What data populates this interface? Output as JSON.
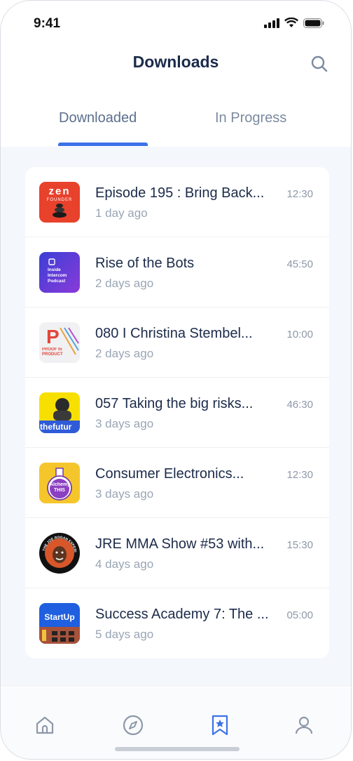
{
  "status": {
    "time": "9:41"
  },
  "header": {
    "title": "Downloads"
  },
  "tabs": [
    {
      "label": "Downloaded",
      "active": true
    },
    {
      "label": "In Progress",
      "active": false
    }
  ],
  "episodes": [
    {
      "title": "Episode 195 : Bring Back...",
      "date": "1 day ago",
      "duration": "12:30",
      "art": "zen-founder-art",
      "art_text": "zen",
      "art_subtext": "FOUNDER"
    },
    {
      "title": "Rise of the Bots",
      "date": "2 days ago",
      "duration": "45:50",
      "art": "inside-intercom-art",
      "art_text": "Inside Intercom Podcast"
    },
    {
      "title": "080 I Christina Stembel...",
      "date": "2 days ago",
      "duration": "10:00",
      "art": "proof-to-product-art",
      "art_text": "PROOF to PRODUCT"
    },
    {
      "title": "057 Taking the big risks...",
      "date": "3 days ago",
      "duration": "46:30",
      "art": "the-futur-art",
      "art_text": "thefutur"
    },
    {
      "title": "Consumer Electronics...",
      "date": "3 days ago",
      "duration": "12:30",
      "art": "alchemy-this-art",
      "art_text": "Alchemy THIS"
    },
    {
      "title": "JRE MMA Show #53 with...",
      "date": "4 days ago",
      "duration": "15:30",
      "art": "joe-rogan-art",
      "art_text": "THE JOE ROGAN EXPERIENCE"
    },
    {
      "title": "Success Academy 7: The ...",
      "date": "5 days ago",
      "duration": "05:00",
      "art": "startup-art",
      "art_text": "StartUp"
    }
  ],
  "nav": [
    {
      "icon": "home-icon",
      "active": false
    },
    {
      "icon": "compass-icon",
      "active": false
    },
    {
      "icon": "bookmark-star-icon",
      "active": true
    },
    {
      "icon": "profile-icon",
      "active": false
    }
  ],
  "colors": {
    "accent": "#3d72e8",
    "title": "#1c2b4a",
    "muted": "#9aa5b5",
    "background": "#f4f7fb"
  }
}
